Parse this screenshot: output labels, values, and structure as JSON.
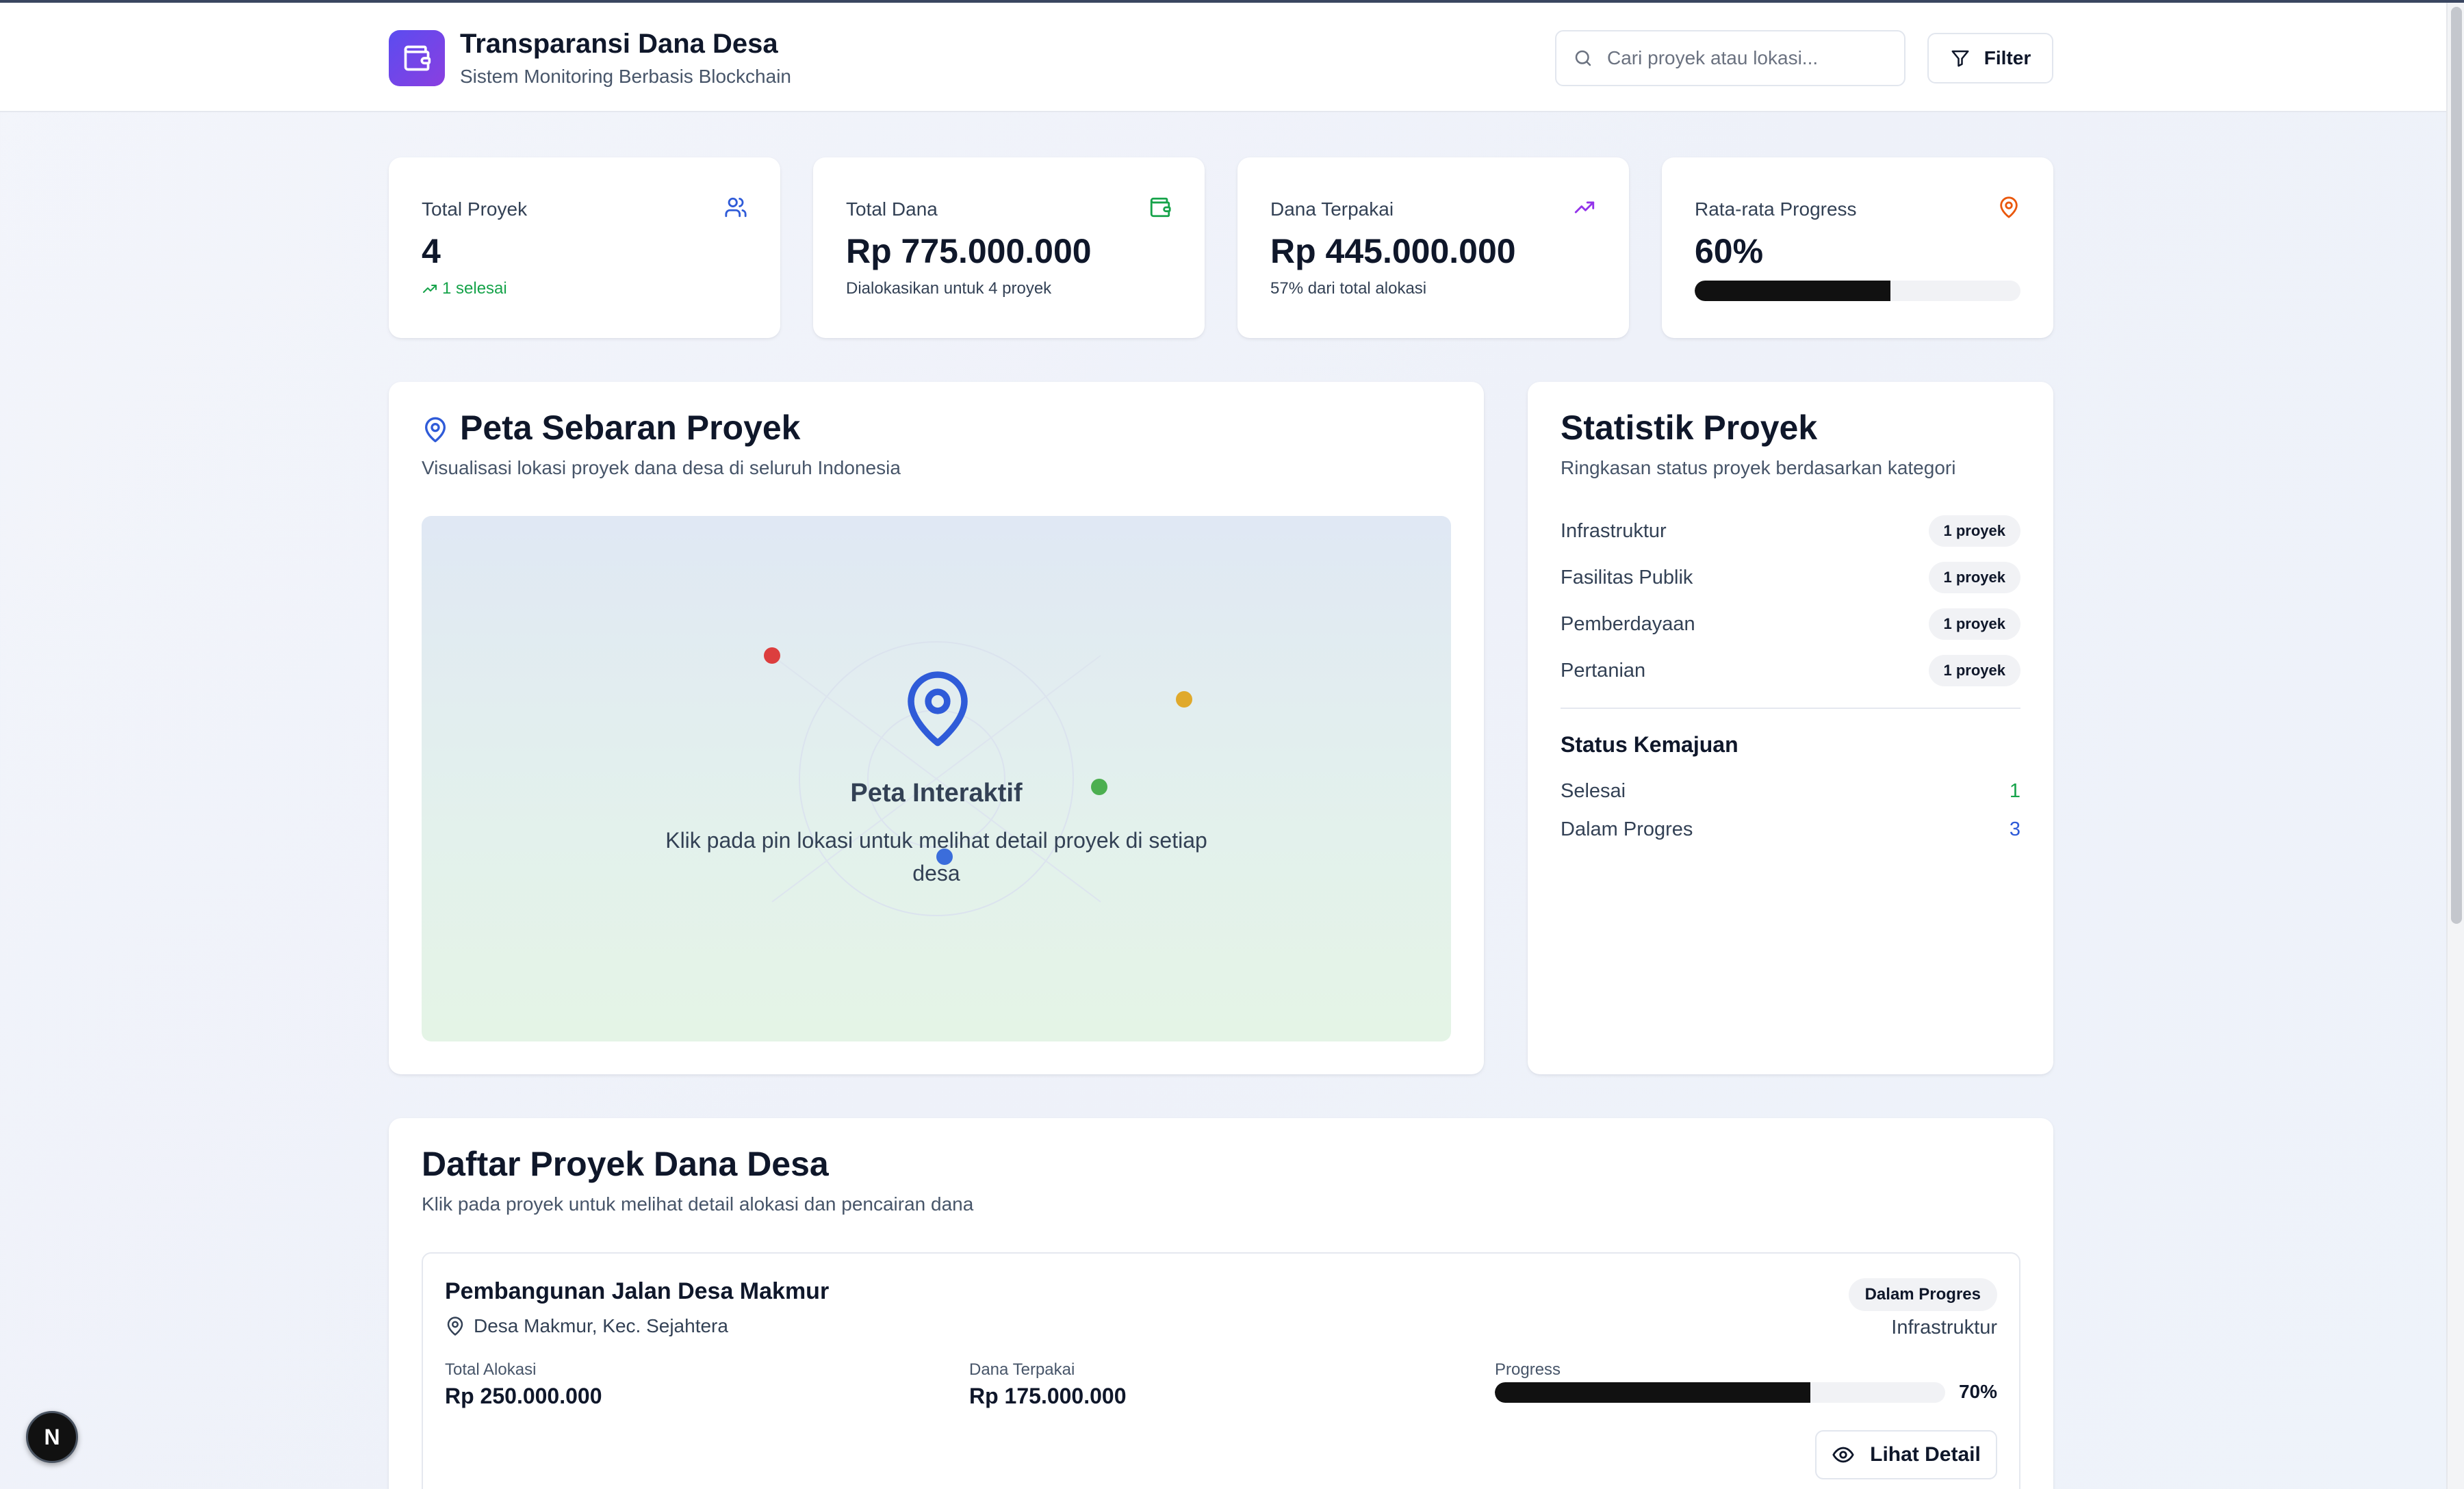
{
  "header": {
    "title": "Transparansi Dana Desa",
    "subtitle": "Sistem Monitoring Berbasis Blockchain",
    "search_placeholder": "Cari proyek atau lokasi...",
    "filter_label": "Filter",
    "logo_icon": "wallet-icon"
  },
  "stats": [
    {
      "label": "Total Proyek",
      "value": "4",
      "sub": "1 selesai",
      "icon": "users-icon",
      "icon_color": "#2f5bd8",
      "sub_color": "#16a34a"
    },
    {
      "label": "Total Dana",
      "value": "Rp 775.000.000",
      "sub": "Dialokasikan untuk 4 proyek",
      "icon": "wallet-icon",
      "icon_color": "#16a34a"
    },
    {
      "label": "Dana Terpakai",
      "value": "Rp 445.000.000",
      "sub": "57% dari total alokasi",
      "icon": "trending-up-icon",
      "icon_color": "#9333ea"
    },
    {
      "label": "Rata-rata Progress",
      "value": "60%",
      "progress": 0.6,
      "icon": "map-pin-icon",
      "icon_color": "#ea580c"
    }
  ],
  "map_section": {
    "title": "Peta Sebaran Proyek",
    "subtitle": "Visualisasi lokasi proyek dana desa di seluruh Indonesia",
    "map_title": "Peta Interaktif",
    "map_description": "Klik pada pin lokasi untuk melihat detail proyek di setiap desa",
    "pins": [
      {
        "color": "#dc3e3e"
      },
      {
        "color": "#e0a92b"
      },
      {
        "color": "#4caf50"
      },
      {
        "color": "#3b6ddb"
      }
    ]
  },
  "statistics": {
    "title": "Statistik Proyek",
    "subtitle": "Ringkasan status proyek berdasarkan kategori",
    "categories": [
      {
        "name": "Infrastruktur",
        "count": "1 proyek"
      },
      {
        "name": "Fasilitas Publik",
        "count": "1 proyek"
      },
      {
        "name": "Pemberdayaan",
        "count": "1 proyek"
      },
      {
        "name": "Pertanian",
        "count": "1 proyek"
      }
    ],
    "status_title": "Status Kemajuan",
    "status": [
      {
        "label": "Selesai",
        "value": "1",
        "color": "#16a34a"
      },
      {
        "label": "Dalam Progres",
        "value": "3",
        "color": "#2f5bd8"
      }
    ]
  },
  "projects_section": {
    "title": "Daftar Proyek Dana Desa",
    "subtitle": "Klik pada proyek untuk melihat detail alokasi dan pencairan dana",
    "projects": [
      {
        "name": "Pembangunan Jalan Desa Makmur",
        "location": "Desa Makmur, Kec. Sejahtera",
        "status": "Dalam Progres",
        "category": "Infrastruktur",
        "alloc_label": "Total Alokasi",
        "alloc_value": "Rp 250.000.000",
        "spent_label": "Dana Terpakai",
        "spent_value": "Rp 175.000.000",
        "progress_label": "Progress",
        "progress": 0.7,
        "progress_text": "70%",
        "detail_label": "Lihat Detail"
      }
    ]
  },
  "dev_badge": "N"
}
